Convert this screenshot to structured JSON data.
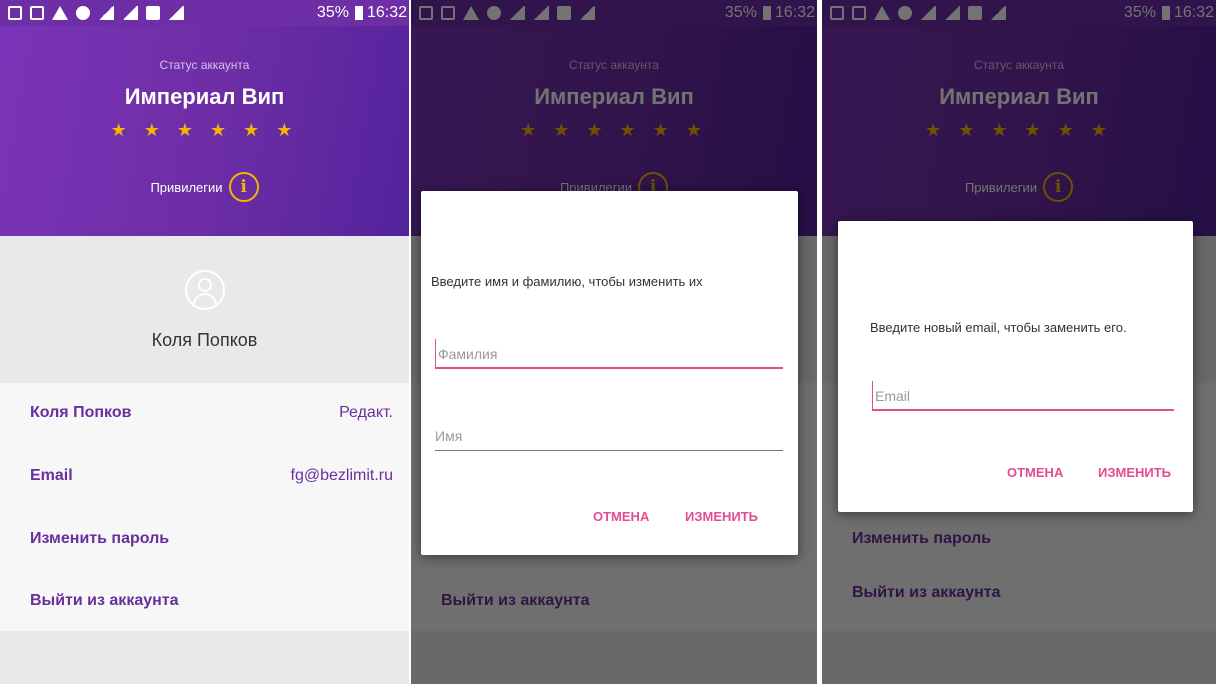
{
  "status_bar": {
    "battery": "35%",
    "time": "16:32"
  },
  "account": {
    "status_label": "Статус аккаунта",
    "tier_name": "Империал Вип",
    "stars": "★ ★ ★ ★ ★ ★",
    "privileges_label": "Привилегии",
    "info_icon": "i"
  },
  "profile": {
    "full_name": "Коля Попков"
  },
  "settings": {
    "name_label": "Коля Попков",
    "edit_label": "Редакт.",
    "email_label": "Email",
    "email_value": "fg@bezlimit.ru",
    "change_password": "Изменить пароль",
    "logout": "Выйти из аккаунта"
  },
  "name_dialog": {
    "prompt": "Введите имя и фамилию, чтобы изменить их",
    "surname_placeholder": "Фамилия",
    "firstname_placeholder": "Имя",
    "cancel": "ОТМЕНА",
    "confirm": "ИЗМЕНИТЬ"
  },
  "email_dialog": {
    "prompt": "Введите новый email, чтобы заменить его.",
    "email_placeholder": "Email",
    "cancel": "ОТМЕНА",
    "confirm": "ИЗМЕНИТЬ"
  },
  "colors": {
    "header_purple": "#6e2ea6",
    "star_gold": "#f5b400",
    "accent_pink": "#e24d8f",
    "list_text_purple": "#6a2f9e"
  }
}
